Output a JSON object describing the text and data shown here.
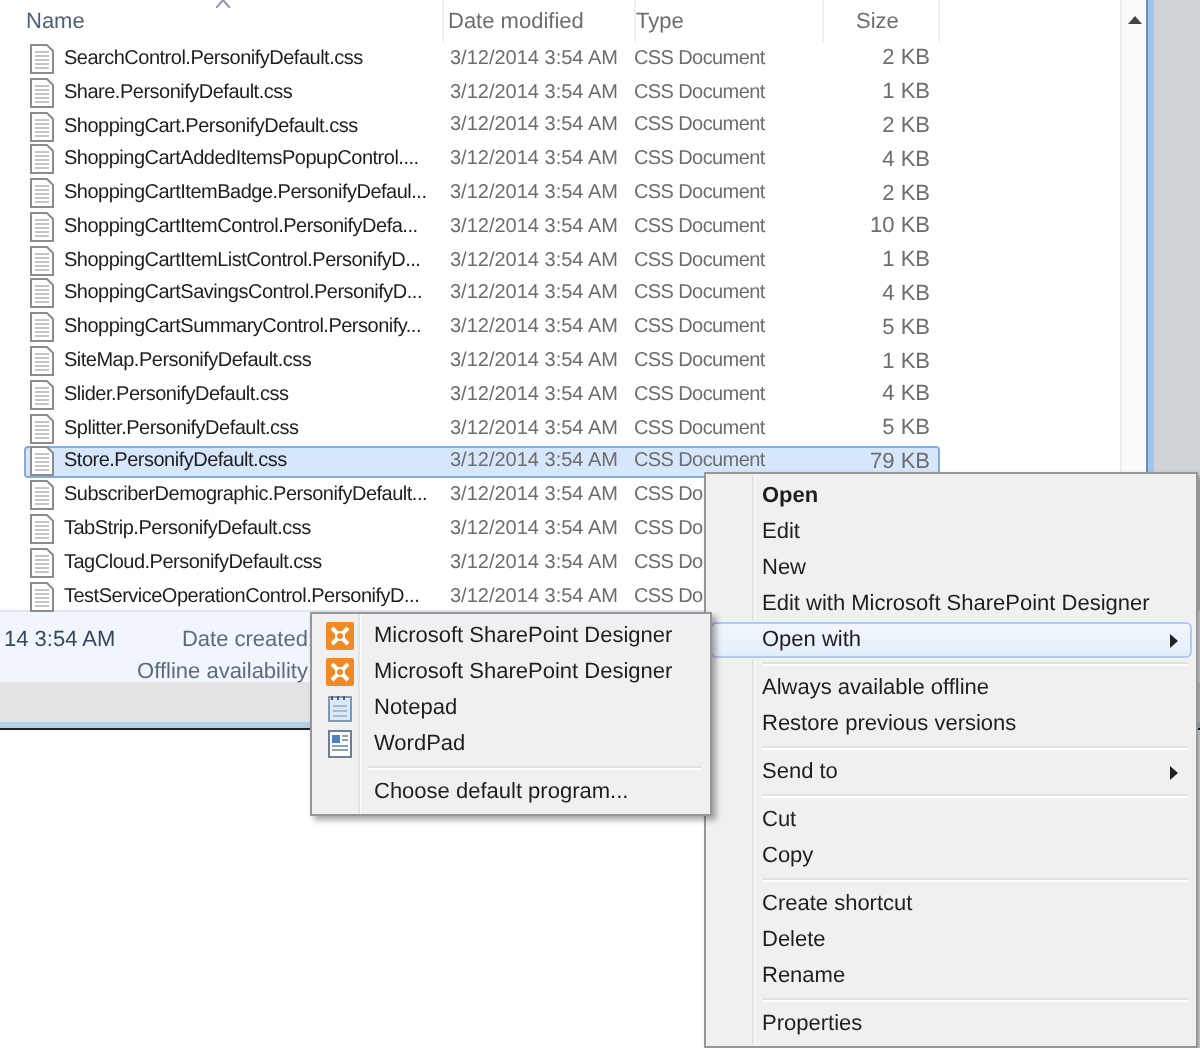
{
  "file_list": {
    "columns": [
      {
        "label": "Name",
        "sorted": true
      },
      {
        "label": "Date modified",
        "sorted": false
      },
      {
        "label": "Type",
        "sorted": false
      },
      {
        "label": "Size",
        "sorted": false
      }
    ],
    "rows": [
      {
        "name": "SearchControl.PersonifyDefault.css",
        "date": "3/12/2014 3:54 AM",
        "type": "CSS Document",
        "size": "2 KB",
        "selected": false
      },
      {
        "name": "Share.PersonifyDefault.css",
        "date": "3/12/2014 3:54 AM",
        "type": "CSS Document",
        "size": "1 KB",
        "selected": false
      },
      {
        "name": "ShoppingCart.PersonifyDefault.css",
        "date": "3/12/2014 3:54 AM",
        "type": "CSS Document",
        "size": "2 KB",
        "selected": false
      },
      {
        "name": "ShoppingCartAddedItemsPopupControl....",
        "date": "3/12/2014 3:54 AM",
        "type": "CSS Document",
        "size": "4 KB",
        "selected": false
      },
      {
        "name": "ShoppingCartItemBadge.PersonifyDefaul...",
        "date": "3/12/2014 3:54 AM",
        "type": "CSS Document",
        "size": "2 KB",
        "selected": false
      },
      {
        "name": "ShoppingCartItemControl.PersonifyDefa...",
        "date": "3/12/2014 3:54 AM",
        "type": "CSS Document",
        "size": "10 KB",
        "selected": false
      },
      {
        "name": "ShoppingCartItemListControl.PersonifyD...",
        "date": "3/12/2014 3:54 AM",
        "type": "CSS Document",
        "size": "1 KB",
        "selected": false
      },
      {
        "name": "ShoppingCartSavingsControl.PersonifyD...",
        "date": "3/12/2014 3:54 AM",
        "type": "CSS Document",
        "size": "4 KB",
        "selected": false
      },
      {
        "name": "ShoppingCartSummaryControl.Personify...",
        "date": "3/12/2014 3:54 AM",
        "type": "CSS Document",
        "size": "5 KB",
        "selected": false
      },
      {
        "name": "SiteMap.PersonifyDefault.css",
        "date": "3/12/2014 3:54 AM",
        "type": "CSS Document",
        "size": "1 KB",
        "selected": false
      },
      {
        "name": "Slider.PersonifyDefault.css",
        "date": "3/12/2014 3:54 AM",
        "type": "CSS Document",
        "size": "4 KB",
        "selected": false
      },
      {
        "name": "Splitter.PersonifyDefault.css",
        "date": "3/12/2014 3:54 AM",
        "type": "CSS Document",
        "size": "5 KB",
        "selected": false
      },
      {
        "name": "Store.PersonifyDefault.css",
        "date": "3/12/2014 3:54 AM",
        "type": "CSS Document",
        "size": "79 KB",
        "selected": true
      },
      {
        "name": "SubscriberDemographic.PersonifyDefault...",
        "date": "3/12/2014 3:54 AM",
        "type": "CSS Do",
        "selected": false
      },
      {
        "name": "TabStrip.PersonifyDefault.css",
        "date": "3/12/2014 3:54 AM",
        "type": "CSS Do",
        "selected": false
      },
      {
        "name": "TagCloud.PersonifyDefault.css",
        "date": "3/12/2014 3:54 AM",
        "type": "CSS Do",
        "selected": false
      },
      {
        "name": "TestServiceOperationControl.PersonifyD...",
        "date": "3/12/2014 3:54 AM",
        "type": "CSS Do",
        "selected": false
      }
    ]
  },
  "details_pane": {
    "value": "14 3:54 AM",
    "labels": [
      "Date created:",
      "Offline availability:"
    ]
  },
  "context_menu": {
    "items": [
      {
        "kind": "item",
        "label": "Open",
        "default": true,
        "submenu": false,
        "selected": false
      },
      {
        "kind": "item",
        "label": "Edit",
        "default": false,
        "submenu": false,
        "selected": false
      },
      {
        "kind": "item",
        "label": "New",
        "default": false,
        "submenu": false,
        "selected": false
      },
      {
        "kind": "item",
        "label": "Edit with Microsoft SharePoint Designer",
        "default": false,
        "submenu": false,
        "selected": false
      },
      {
        "kind": "item",
        "label": "Open with",
        "default": false,
        "submenu": true,
        "selected": true
      },
      {
        "kind": "separator"
      },
      {
        "kind": "item",
        "label": "Always available offline",
        "default": false,
        "submenu": false,
        "selected": false
      },
      {
        "kind": "item",
        "label": "Restore previous versions",
        "default": false,
        "submenu": false,
        "selected": false
      },
      {
        "kind": "separator"
      },
      {
        "kind": "item",
        "label": "Send to",
        "default": false,
        "submenu": true,
        "selected": false
      },
      {
        "kind": "separator"
      },
      {
        "kind": "item",
        "label": "Cut",
        "default": false,
        "submenu": false,
        "selected": false
      },
      {
        "kind": "item",
        "label": "Copy",
        "default": false,
        "submenu": false,
        "selected": false
      },
      {
        "kind": "separator"
      },
      {
        "kind": "item",
        "label": "Create shortcut",
        "default": false,
        "submenu": false,
        "selected": false
      },
      {
        "kind": "item",
        "label": "Delete",
        "default": false,
        "submenu": false,
        "selected": false
      },
      {
        "kind": "item",
        "label": "Rename",
        "default": false,
        "submenu": false,
        "selected": false
      },
      {
        "kind": "separator"
      },
      {
        "kind": "item",
        "label": "Properties",
        "default": false,
        "submenu": false,
        "selected": false
      }
    ]
  },
  "open_with_menu": {
    "items": [
      {
        "kind": "item",
        "label": "Microsoft SharePoint Designer"
      },
      {
        "kind": "item",
        "label": "Microsoft SharePoint Designer"
      },
      {
        "kind": "item",
        "label": "Notepad"
      },
      {
        "kind": "item",
        "label": "WordPad"
      },
      {
        "kind": "separator"
      },
      {
        "kind": "item",
        "label": "Choose default program..."
      }
    ]
  }
}
